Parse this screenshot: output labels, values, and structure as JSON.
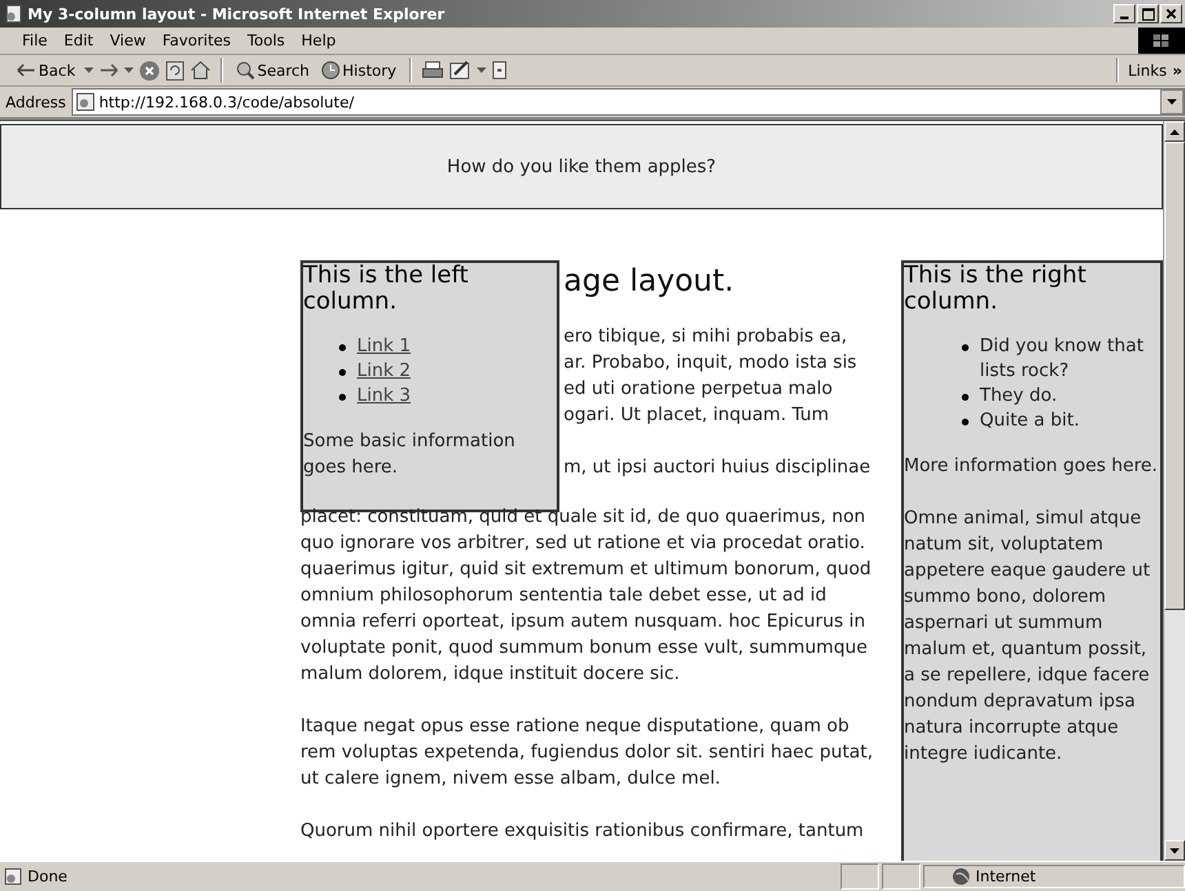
{
  "window": {
    "title": "My 3-column layout - Microsoft Internet Explorer"
  },
  "menu": [
    "File",
    "Edit",
    "View",
    "Favorites",
    "Tools",
    "Help"
  ],
  "toolbar": {
    "back": "Back",
    "search": "Search",
    "history": "History",
    "links": "Links",
    "more": "»"
  },
  "address": {
    "label": "Address",
    "value": "http://192.168.0.3/code/absolute/"
  },
  "page": {
    "banner": "How do you like them apples?",
    "left_column": {
      "heading": "This is the left column.",
      "links": [
        "Link 1",
        "Link 2",
        "Link 3"
      ],
      "info": "Some basic information goes here."
    },
    "main": {
      "heading": "age layout.",
      "fragments": [
        "ero tibique, si mihi probabis ea,",
        "ar. Probabo, inquit, modo ista sis",
        "ed uti oratione perpetua malo",
        "ogari. Ut placet, inquam. Tum"
      ],
      "next_fragment": "m, ut ipsi auctori huius disciplinae",
      "paragraphs": [
        "placet: constituam, quid et quale sit id, de quo quaerimus, non quo ignorare vos arbitrer, sed ut ratione et via procedat oratio. quaerimus igitur, quid sit extremum et ultimum bonorum, quod omnium philosophorum sententia tale debet esse, ut ad id omnia referri oporteat, ipsum autem nusquam. hoc Epicurus in voluptate ponit, quod summum bonum esse vult, summumque malum dolorem, idque instituit docere sic.",
        "Itaque negat opus esse ratione neque disputatione, quam ob rem voluptas expetenda, fugiendus dolor sit. sentiri haec putat, ut calere ignem, nivem esse albam, dulce mel.",
        "Quorum nihil oportere exquisitis rationibus confirmare, tantum"
      ]
    },
    "right_column": {
      "heading": "This is the right column.",
      "list": [
        "Did you know that lists rock?",
        "They do.",
        "Quite a bit."
      ],
      "paragraphs": [
        "More information goes here.",
        "Omne animal, simul atque natum sit, voluptatem appetere eaque gaudere ut summo bono, dolorem aspernari ut summum malum et, quantum possit, a se repellere, idque facere nondum depravatum ipsa natura incorrupte atque integre iudicante."
      ]
    }
  },
  "status": {
    "text": "Done",
    "zone": "Internet"
  }
}
